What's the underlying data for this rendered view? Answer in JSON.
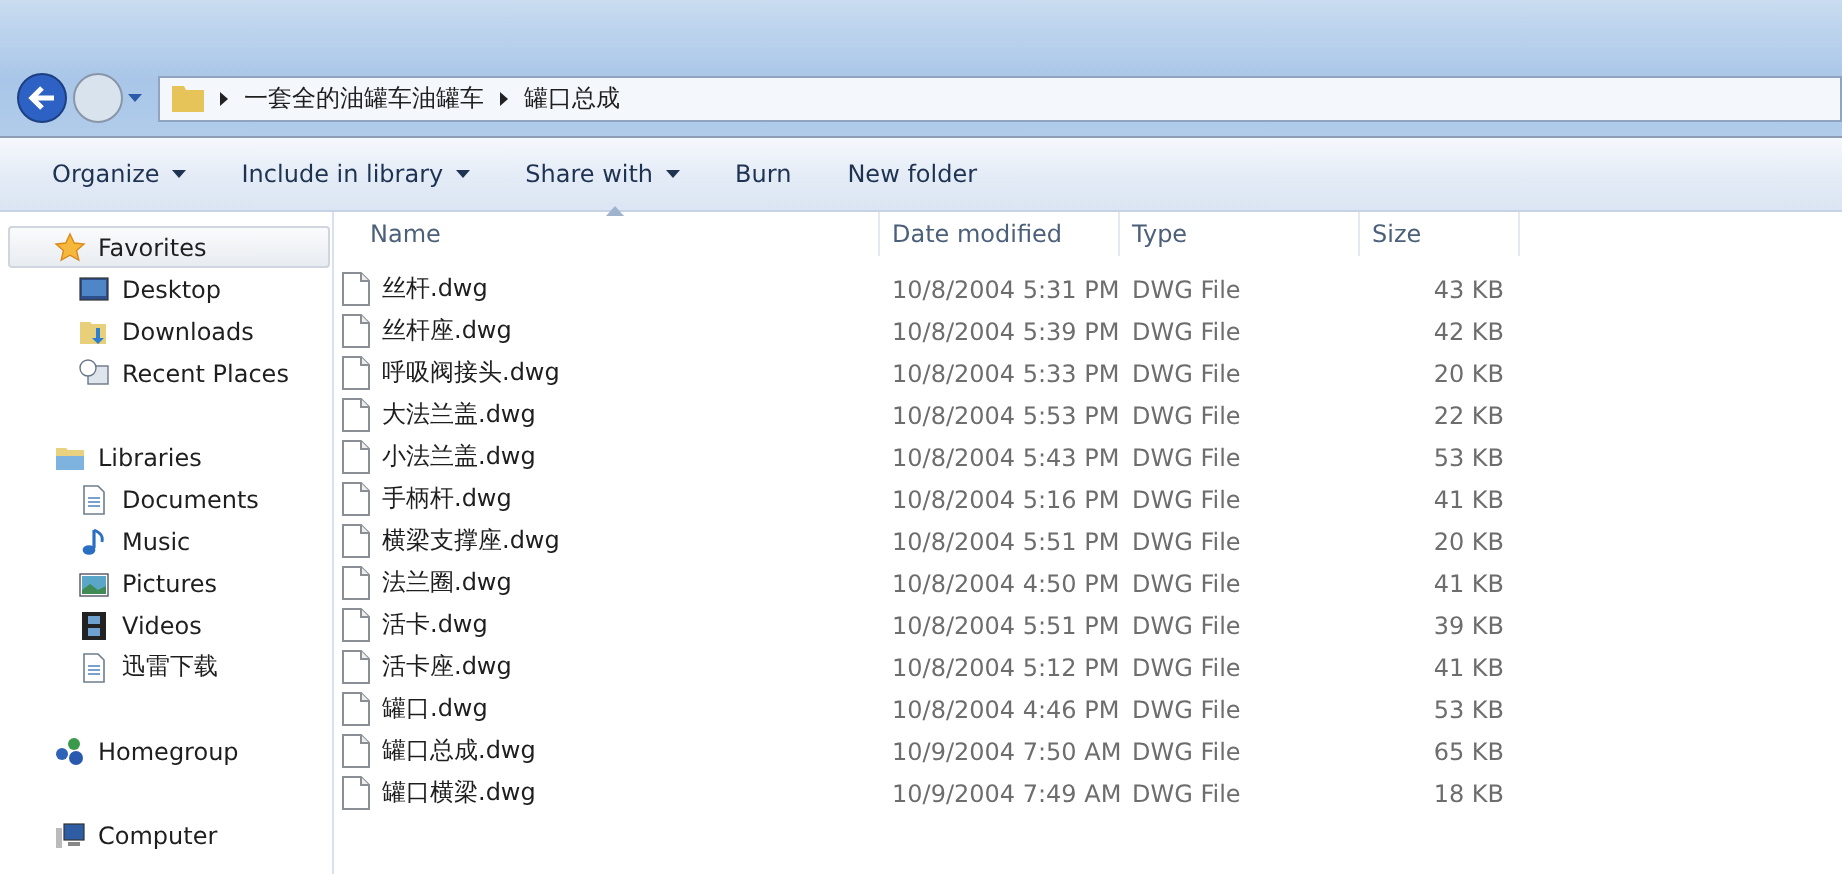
{
  "address_bar": {
    "segments": [
      "一套全的油罐车油罐车",
      "罐口总成"
    ]
  },
  "toolbar": [
    {
      "label": "Organize",
      "dropdown": true
    },
    {
      "label": "Include in library",
      "dropdown": true
    },
    {
      "label": "Share with",
      "dropdown": true
    },
    {
      "label": "Burn",
      "dropdown": false
    },
    {
      "label": "New folder",
      "dropdown": false
    }
  ],
  "navigation": [
    {
      "label": "Favorites",
      "kind": "star",
      "selected": true,
      "children": [
        {
          "label": "Desktop",
          "kind": "desktop",
          "selected": false
        },
        {
          "label": "Downloads",
          "kind": "downloads",
          "selected": false
        },
        {
          "label": "Recent Places",
          "kind": "recent",
          "selected": false
        }
      ]
    },
    {
      "label": "Libraries",
      "kind": "library",
      "selected": false,
      "children": [
        {
          "label": "Documents",
          "kind": "document",
          "selected": false
        },
        {
          "label": "Music",
          "kind": "music",
          "selected": false
        },
        {
          "label": "Pictures",
          "kind": "pictures",
          "selected": false
        },
        {
          "label": "Videos",
          "kind": "videos",
          "selected": false
        },
        {
          "label": "迅雷下载",
          "kind": "document",
          "selected": false
        }
      ]
    },
    {
      "label": "Homegroup",
      "kind": "homegroup",
      "selected": false
    },
    {
      "label": "Computer",
      "kind": "computer",
      "selected": false
    }
  ],
  "table": {
    "columns": [
      {
        "label": "Name",
        "sorted": true
      },
      {
        "label": "Date modified",
        "sorted": false
      },
      {
        "label": "Type",
        "sorted": false
      },
      {
        "label": "Size",
        "sorted": false
      }
    ],
    "rows": [
      [
        "丝杆.dwg",
        "10/8/2004 5:31 PM",
        "DWG File",
        "43 KB"
      ],
      [
        "丝杆座.dwg",
        "10/8/2004 5:39 PM",
        "DWG File",
        "42 KB"
      ],
      [
        "呼吸阀接头.dwg",
        "10/8/2004 5:33 PM",
        "DWG File",
        "20 KB"
      ],
      [
        "大法兰盖.dwg",
        "10/8/2004 5:53 PM",
        "DWG File",
        "22 KB"
      ],
      [
        "小法兰盖.dwg",
        "10/8/2004 5:43 PM",
        "DWG File",
        "53 KB"
      ],
      [
        "手柄杆.dwg",
        "10/8/2004 5:16 PM",
        "DWG File",
        "41 KB"
      ],
      [
        "横梁支撑座.dwg",
        "10/8/2004 5:51 PM",
        "DWG File",
        "20 KB"
      ],
      [
        "法兰圈.dwg",
        "10/8/2004 4:50 PM",
        "DWG File",
        "41 KB"
      ],
      [
        "活卡.dwg",
        "10/8/2004 5:51 PM",
        "DWG File",
        "39 KB"
      ],
      [
        "活卡座.dwg",
        "10/8/2004 5:12 PM",
        "DWG File",
        "41 KB"
      ],
      [
        "罐口.dwg",
        "10/8/2004 4:46 PM",
        "DWG File",
        "53 KB"
      ],
      [
        "罐口总成.dwg",
        "10/9/2004 7:50 AM",
        "DWG File",
        "65 KB"
      ],
      [
        "罐口横梁.dwg",
        "10/9/2004 7:49 AM",
        "DWG File",
        "18 KB"
      ]
    ]
  }
}
